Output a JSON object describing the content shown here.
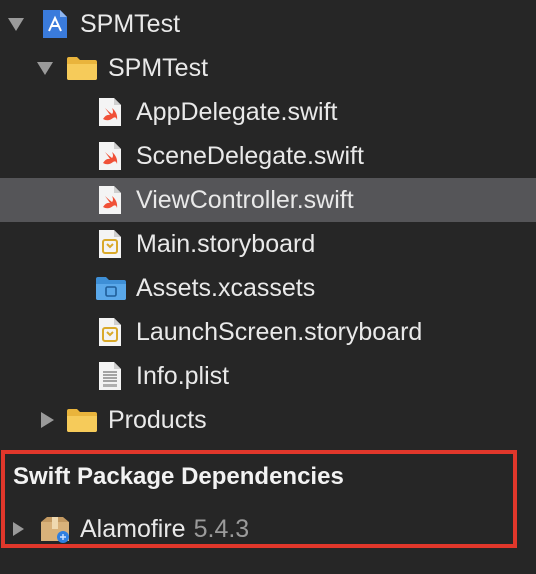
{
  "navigator": {
    "project": {
      "label": "SPMTest",
      "icon": "xcode-project-icon"
    },
    "group": {
      "label": "SPMTest",
      "icon": "folder-icon"
    },
    "files": [
      {
        "label": "AppDelegate.swift",
        "icon": "swift-file-icon"
      },
      {
        "label": "SceneDelegate.swift",
        "icon": "swift-file-icon"
      },
      {
        "label": "ViewController.swift",
        "icon": "swift-file-icon",
        "selected": true
      },
      {
        "label": "Main.storyboard",
        "icon": "storyboard-file-icon"
      },
      {
        "label": "Assets.xcassets",
        "icon": "asset-catalog-icon"
      },
      {
        "label": "LaunchScreen.storyboard",
        "icon": "storyboard-file-icon"
      },
      {
        "label": "Info.plist",
        "icon": "plist-file-icon"
      }
    ],
    "products": {
      "label": "Products",
      "icon": "folder-icon"
    }
  },
  "dependencies": {
    "header": "Swift Package Dependencies",
    "packages": [
      {
        "name": "Alamofire",
        "version": "5.4.3",
        "icon": "swift-package-icon"
      }
    ]
  },
  "colors": {
    "background": "#262626",
    "selection": "#555558",
    "highlight": "#e0372b",
    "folder": "#f2c14e",
    "swift": "#f05138"
  }
}
